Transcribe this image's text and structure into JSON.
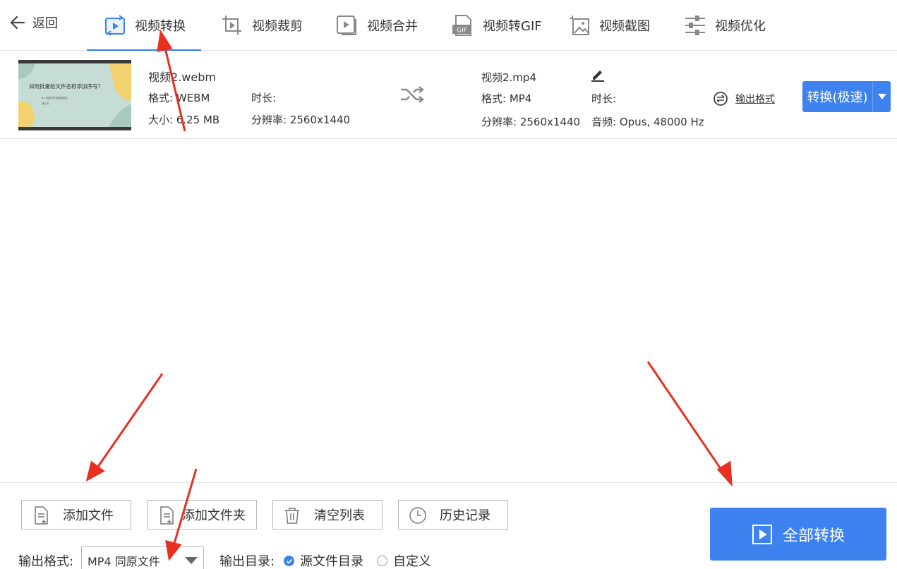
{
  "nav": {
    "back_label": "返回",
    "tabs": [
      {
        "label": "视频转换",
        "icon": "video-convert-icon",
        "active": true
      },
      {
        "label": "视频裁剪",
        "icon": "video-crop-icon",
        "active": false
      },
      {
        "label": "视频合并",
        "icon": "video-merge-icon",
        "active": false
      },
      {
        "label": "视频转GIF",
        "icon": "gif-icon",
        "active": false
      },
      {
        "label": "视频截图",
        "icon": "image-capture-icon",
        "active": false
      },
      {
        "label": "视频优化",
        "icon": "sliders-icon",
        "active": false
      }
    ],
    "gif_badge": "GIF"
  },
  "file": {
    "thumbnail": {
      "title": "如何批量给文件名称添加序号?",
      "subtitle": "By 优速文件批量重命名",
      "footnote": "演示文"
    },
    "source": {
      "name": "视频2.webm",
      "format": "格式: WEBM",
      "duration": "时长:",
      "size": "大小: 6.25 MB",
      "resolution": "分辨率: 2560x1440"
    },
    "target": {
      "name": "视频2.mp4",
      "format": "格式: MP4",
      "duration": "时长:",
      "resolution": "分辨率: 2560x1440",
      "audio": "音频: Opus, 48000 Hz"
    },
    "output_format_link": "输出格式",
    "convert_button": "转换(极速)"
  },
  "bottom": {
    "buttons": {
      "add_file": "添加文件",
      "add_folder": "添加文件夹",
      "clear_list": "清空列表",
      "history": "历史记录"
    },
    "output_format_label": "输出格式:",
    "output_format_value": "MP4 同原文件",
    "output_dir_label": "输出目录:",
    "dir_options": [
      {
        "label": "源文件目录",
        "selected": true
      },
      {
        "label": "自定义",
        "selected": false
      }
    ],
    "convert_all": "全部转换"
  },
  "colors": {
    "accent": "#3d82ef",
    "annotation_arrow": "#e8301f"
  }
}
